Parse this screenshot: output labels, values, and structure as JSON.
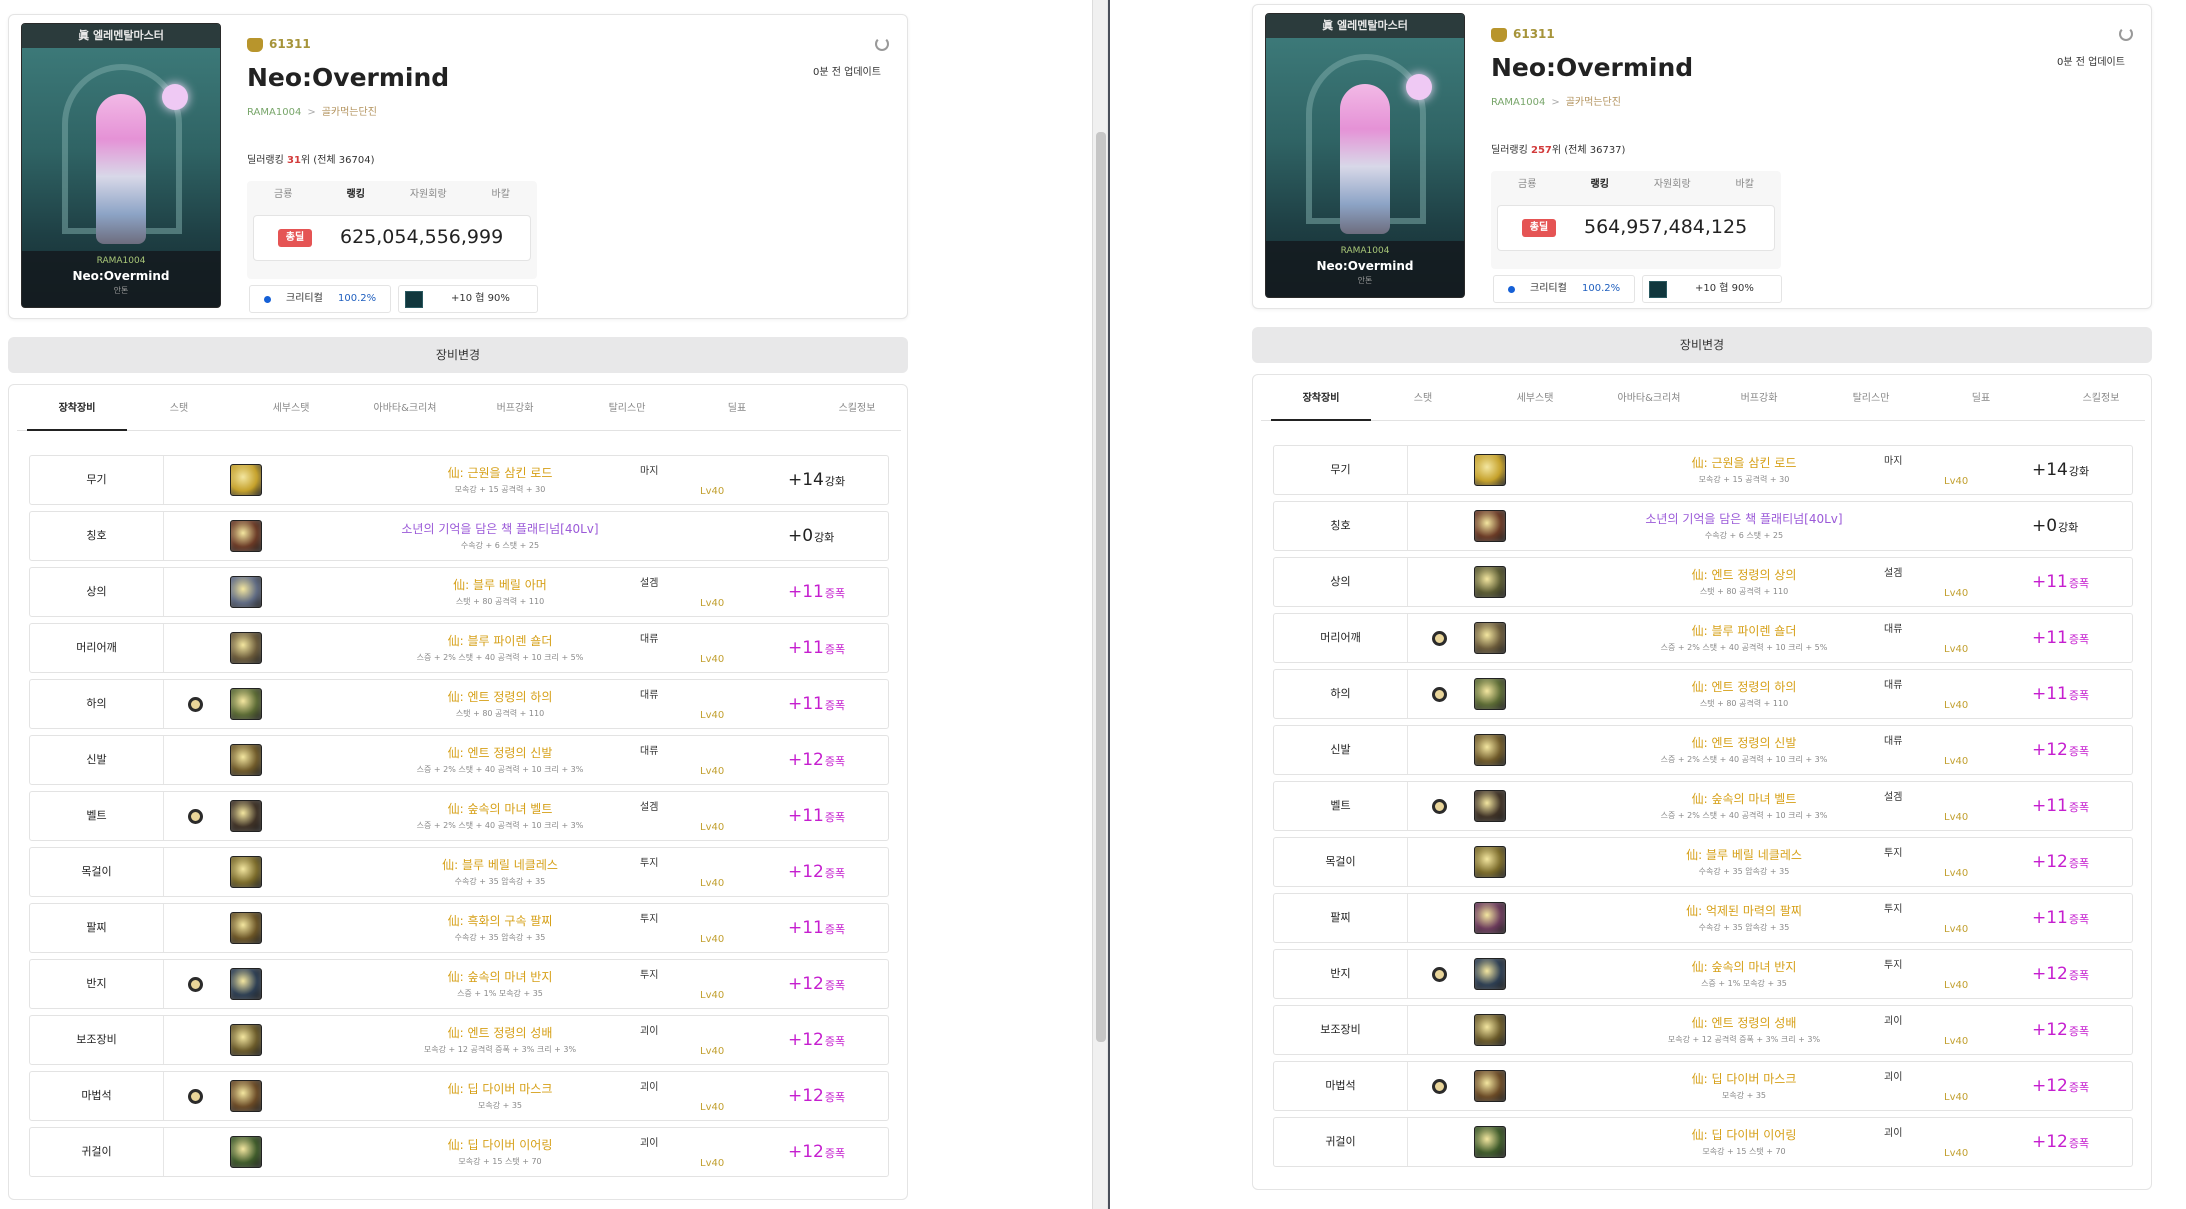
{
  "colors": {
    "name_gold": "#d6a018",
    "name_purple": "#9b5ad8",
    "enh_pink": "#c51ecf",
    "badge_red": "#e55454",
    "crit_blue": "#1f5fbf"
  },
  "icons": {
    "guild": "guild-emblem-icon",
    "refresh": "refresh-icon",
    "rune": "rune-icon"
  },
  "left": {
    "avatar": {
      "header": "眞 엘레멘탈마스터",
      "id": "RAMA1004",
      "name": "Neo:Overmind",
      "sub": "안톤"
    },
    "guild_id": "61311",
    "name": "Neo:Overmind",
    "breadcrumb": [
      "RAMA1004",
      "골카먹는단진"
    ],
    "rank": {
      "prefix": "딜러랭킹",
      "value": "31",
      "suffix": "위 (전체 36704)"
    },
    "updated": "0분 전 업데이트",
    "stat_tabs": [
      "금룡",
      "랭킹",
      "자원회랑",
      "바칼"
    ],
    "stat_badge": "총딜",
    "stat_value": "625,054,556,999",
    "crit": {
      "label": "크리티컬",
      "value": "100.2%"
    },
    "enh": {
      "label": "+10 협 90%"
    },
    "equip_button": "장비변경",
    "tabs": [
      "장착장비",
      "스탯",
      "세부스탯",
      "아바타&크리쳐",
      "버프강화",
      "탈리스만",
      "딜표",
      "스킬정보"
    ],
    "items": [
      {
        "slot": "무기",
        "name": "仙: 근원을 삼킨 로드",
        "stats": "모속강 + 15 공격력 + 30",
        "type": "마지",
        "lv": "Lv40",
        "enh": "+14",
        "enh_unit": "강화",
        "rune": false,
        "pink": false,
        "purple": false,
        "color": "#c5a12b"
      },
      {
        "slot": "칭호",
        "name": "소년의 기억을 담은 책 플래티넘[40Lv]",
        "stats": "수속강 + 6 스탯 + 25",
        "type": "",
        "lv": "",
        "enh": "+0",
        "enh_unit": "강화",
        "rune": false,
        "pink": false,
        "purple": true,
        "color": "#6a3a26"
      },
      {
        "slot": "상의",
        "name": "仙: 블루 베릴 아머",
        "stats": "스탯 + 80 공격력 + 110",
        "type": "설겜",
        "lv": "Lv40",
        "enh": "+11",
        "enh_unit": "증폭",
        "rune": false,
        "pink": true,
        "purple": false,
        "color": "#5f6a82"
      },
      {
        "slot": "머리어깨",
        "name": "仙: 블루 파이렌 숄더",
        "stats": "스증 + 2% 스탯 + 40 공격력 + 10 크리 + 5%",
        "type": "대류",
        "lv": "Lv40",
        "enh": "+11",
        "enh_unit": "증폭",
        "rune": false,
        "pink": true,
        "purple": false,
        "color": "#6a5a3a"
      },
      {
        "slot": "하의",
        "name": "仙: 엔트 정령의 하의",
        "stats": "스탯 + 80 공격력 + 110",
        "type": "대류",
        "lv": "Lv40",
        "enh": "+11",
        "enh_unit": "증폭",
        "rune": true,
        "pink": true,
        "purple": false,
        "color": "#5b6a34"
      },
      {
        "slot": "신발",
        "name": "仙: 엔트 정령의 신발",
        "stats": "스증 + 2% 스탯 + 40 공격력 + 10 크리 + 3%",
        "type": "대류",
        "lv": "Lv40",
        "enh": "+12",
        "enh_unit": "증폭",
        "rune": false,
        "pink": true,
        "purple": false,
        "color": "#6f5a2a"
      },
      {
        "slot": "벨트",
        "name": "仙: 숲속의 마녀 벨트",
        "stats": "스증 + 2% 스탯 + 40 공격력 + 10 크리 + 3%",
        "type": "설겜",
        "lv": "Lv40",
        "enh": "+11",
        "enh_unit": "증폭",
        "rune": true,
        "pink": true,
        "purple": false,
        "color": "#3f3226"
      },
      {
        "slot": "목걸이",
        "name": "仙: 블루 베릴 네클레스",
        "stats": "수속강 + 35 암속강 + 35",
        "type": "투지",
        "lv": "Lv40",
        "enh": "+12",
        "enh_unit": "증폭",
        "rune": false,
        "pink": true,
        "purple": false,
        "color": "#7a6a2a"
      },
      {
        "slot": "팔찌",
        "name": "仙: 흑화의 구속 팔찌",
        "stats": "수속강 + 35 암속강 + 35",
        "type": "투지",
        "lv": "Lv40",
        "enh": "+11",
        "enh_unit": "증폭",
        "rune": false,
        "pink": true,
        "purple": false,
        "color": "#6a5426"
      },
      {
        "slot": "반지",
        "name": "仙: 숲속의 마녀 반지",
        "stats": "스증 + 1% 모속강 + 35",
        "type": "투지",
        "lv": "Lv40",
        "enh": "+12",
        "enh_unit": "증폭",
        "rune": true,
        "pink": true,
        "purple": false,
        "color": "#2d3e52"
      },
      {
        "slot": "보조장비",
        "name": "仙: 엔트 정령의 성배",
        "stats": "모속강 + 12 공격력 증폭 + 3% 크리 + 3%",
        "type": "괴이",
        "lv": "Lv40",
        "enh": "+12",
        "enh_unit": "증폭",
        "rune": false,
        "pink": true,
        "purple": false,
        "color": "#6a5a2a"
      },
      {
        "slot": "마법석",
        "name": "仙: 딥 다이버 마스크",
        "stats": "모속강 + 35",
        "type": "괴이",
        "lv": "Lv40",
        "enh": "+12",
        "enh_unit": "증폭",
        "rune": true,
        "pink": true,
        "purple": false,
        "color": "#6a4a26"
      },
      {
        "slot": "귀걸이",
        "name": "仙: 딥 다이버 이어링",
        "stats": "모속강 + 15 스탯 + 70",
        "type": "괴이",
        "lv": "Lv40",
        "enh": "+12",
        "enh_unit": "증폭",
        "rune": false,
        "pink": true,
        "purple": false,
        "color": "#3e5a2a"
      }
    ]
  },
  "right": {
    "avatar": {
      "header": "眞 엘레멘탈마스터",
      "id": "RAMA1004",
      "name": "Neo:Overmind",
      "sub": "안톤"
    },
    "guild_id": "61311",
    "name": "Neo:Overmind",
    "breadcrumb": [
      "RAMA1004",
      "골카먹는단진"
    ],
    "rank": {
      "prefix": "딜러랭킹",
      "value": "257",
      "suffix": "위 (전체 36737)"
    },
    "updated": "0분 전 업데이트",
    "stat_tabs": [
      "금룡",
      "랭킹",
      "자원회랑",
      "바칼"
    ],
    "stat_badge": "총딜",
    "stat_value": "564,957,484,125",
    "crit": {
      "label": "크리티컬",
      "value": "100.2%"
    },
    "enh": {
      "label": "+10 협 90%"
    },
    "equip_button": "장비변경",
    "tabs": [
      "장착장비",
      "스탯",
      "세부스탯",
      "아바타&크리쳐",
      "버프강화",
      "탈리스만",
      "딜표",
      "스킬정보"
    ],
    "items": [
      {
        "slot": "무기",
        "name": "仙: 근원을 삼킨 로드",
        "stats": "모속강 + 15 공격력 + 30",
        "type": "마지",
        "lv": "Lv40",
        "enh": "+14",
        "enh_unit": "강화",
        "rune": false,
        "pink": false,
        "purple": false,
        "color": "#c5a12b"
      },
      {
        "slot": "칭호",
        "name": "소년의 기억을 담은 책 플래티넘[40Lv]",
        "stats": "수속강 + 6 스탯 + 25",
        "type": "",
        "lv": "",
        "enh": "+0",
        "enh_unit": "강화",
        "rune": false,
        "pink": false,
        "purple": true,
        "color": "#6a3a26"
      },
      {
        "slot": "상의",
        "name": "仙: 엔트 정령의 상의",
        "stats": "스탯 + 80 공격력 + 110",
        "type": "설겜",
        "lv": "Lv40",
        "enh": "+11",
        "enh_unit": "증폭",
        "rune": false,
        "pink": true,
        "purple": false,
        "color": "#5a5a32"
      },
      {
        "slot": "머리어깨",
        "name": "仙: 블루 파이렌 숄더",
        "stats": "스증 + 2% 스탯 + 40 공격력 + 10 크리 + 5%",
        "type": "대류",
        "lv": "Lv40",
        "enh": "+11",
        "enh_unit": "증폭",
        "rune": true,
        "pink": true,
        "purple": false,
        "color": "#6a5a3a"
      },
      {
        "slot": "하의",
        "name": "仙: 엔트 정령의 하의",
        "stats": "스탯 + 80 공격력 + 110",
        "type": "대류",
        "lv": "Lv40",
        "enh": "+11",
        "enh_unit": "증폭",
        "rune": true,
        "pink": true,
        "purple": false,
        "color": "#5b6a34"
      },
      {
        "slot": "신발",
        "name": "仙: 엔트 정령의 신발",
        "stats": "스증 + 2% 스탯 + 40 공격력 + 10 크리 + 3%",
        "type": "대류",
        "lv": "Lv40",
        "enh": "+12",
        "enh_unit": "증폭",
        "rune": false,
        "pink": true,
        "purple": false,
        "color": "#6f5a2a"
      },
      {
        "slot": "벨트",
        "name": "仙: 숲속의 마녀 벨트",
        "stats": "스증 + 2% 스탯 + 40 공격력 + 10 크리 + 3%",
        "type": "설겜",
        "lv": "Lv40",
        "enh": "+11",
        "enh_unit": "증폭",
        "rune": true,
        "pink": true,
        "purple": false,
        "color": "#3f3226"
      },
      {
        "slot": "목걸이",
        "name": "仙: 블루 베릴 네클레스",
        "stats": "수속강 + 35 암속강 + 35",
        "type": "투지",
        "lv": "Lv40",
        "enh": "+12",
        "enh_unit": "증폭",
        "rune": false,
        "pink": true,
        "purple": false,
        "color": "#7a6a2a"
      },
      {
        "slot": "팔찌",
        "name": "仙: 억제된 마력의 팔찌",
        "stats": "수속강 + 35 암속강 + 35",
        "type": "투지",
        "lv": "Lv40",
        "enh": "+11",
        "enh_unit": "증폭",
        "rune": false,
        "pink": true,
        "purple": false,
        "color": "#6a3a5a"
      },
      {
        "slot": "반지",
        "name": "仙: 숲속의 마녀 반지",
        "stats": "스증 + 1% 모속강 + 35",
        "type": "투지",
        "lv": "Lv40",
        "enh": "+12",
        "enh_unit": "증폭",
        "rune": true,
        "pink": true,
        "purple": false,
        "color": "#2d3e52"
      },
      {
        "slot": "보조장비",
        "name": "仙: 엔트 정령의 성배",
        "stats": "모속강 + 12 공격력 증폭 + 3% 크리 + 3%",
        "type": "괴이",
        "lv": "Lv40",
        "enh": "+12",
        "enh_unit": "증폭",
        "rune": false,
        "pink": true,
        "purple": false,
        "color": "#6a5a2a"
      },
      {
        "slot": "마법석",
        "name": "仙: 딥 다이버 마스크",
        "stats": "모속강 + 35",
        "type": "괴이",
        "lv": "Lv40",
        "enh": "+12",
        "enh_unit": "증폭",
        "rune": true,
        "pink": true,
        "purple": false,
        "color": "#6a4a26"
      },
      {
        "slot": "귀걸이",
        "name": "仙: 딥 다이버 이어링",
        "stats": "모속강 + 15 스탯 + 70",
        "type": "괴이",
        "lv": "Lv40",
        "enh": "+12",
        "enh_unit": "증폭",
        "rune": false,
        "pink": true,
        "purple": false,
        "color": "#3e5a2a"
      }
    ]
  }
}
